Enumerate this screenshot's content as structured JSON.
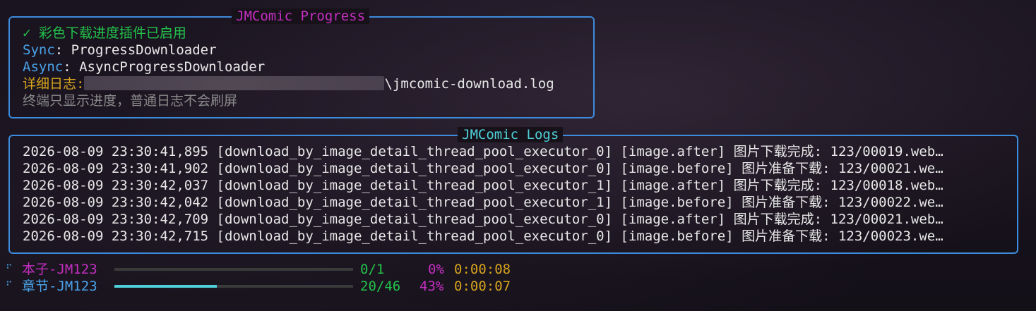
{
  "progress_panel": {
    "title": "JMComic Progress",
    "enabled_msg": "✓ 彩色下载进度插件已启用",
    "sync_label": "Sync",
    "sync_value": ": ProgressDownloader",
    "async_label": "Async",
    "async_value": ": AsyncProgressDownloader",
    "log_label": "详细日志:",
    "log_file": "\\jmcomic-download.log",
    "note": "终端只显示进度，普通日志不会刷屏"
  },
  "logs_panel": {
    "title": "JMComic Logs",
    "lines": [
      "2026-08-09 23:30:41,895 [download_by_image_detail_thread_pool_executor_0] [image.after] 图片下载完成: 123/00019.web…",
      "2026-08-09 23:30:41,902 [download_by_image_detail_thread_pool_executor_0] [image.before] 图片准备下载: 123/00021.we…",
      "2026-08-09 23:30:42,037 [download_by_image_detail_thread_pool_executor_1] [image.after] 图片下载完成: 123/00018.web…",
      "2026-08-09 23:30:42,042 [download_by_image_detail_thread_pool_executor_1] [image.before] 图片准备下载: 123/00022.we…",
      "2026-08-09 23:30:42,709 [download_by_image_detail_thread_pool_executor_0] [image.after] 图片下载完成: 123/00021.web…",
      "2026-08-09 23:30:42,715 [download_by_image_detail_thread_pool_executor_0] [image.before] 图片准备下载: 123/00023.we…"
    ]
  },
  "progress_rows": [
    {
      "spinner": "⠋",
      "label": "本子-JM123",
      "count": "0/1",
      "percent": "0%",
      "elapsed": "0:00:08",
      "fraction": 0.0
    },
    {
      "spinner": "⠋",
      "label": "章节-JM123",
      "count": "20/46",
      "percent": "43%",
      "elapsed": "0:00:07",
      "fraction": 0.43
    }
  ],
  "colors": {
    "border": "#3d8bdc",
    "green": "#22c34b",
    "magenta": "#c42fc0",
    "cyan": "#4fd0d8",
    "yellow": "#d8a51c",
    "blue": "#4aa3ea"
  }
}
